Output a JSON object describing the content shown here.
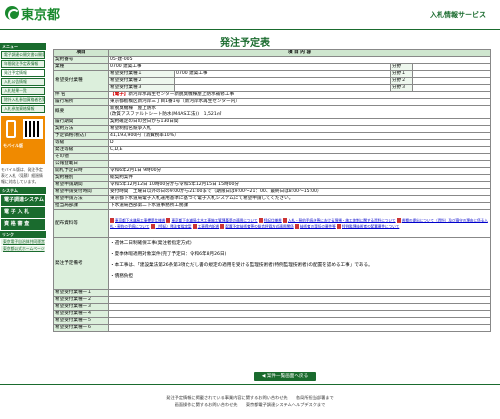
{
  "header": {
    "logo": "東京都",
    "system": "入札情報サービス"
  },
  "page_title": "発注予定表",
  "sidebar": {
    "menu_hd": "メニュー",
    "items": [
      "電子調達公開文書公開条件",
      "年間発注予定表情報",
      "発注予定情報",
      "入札公告情報",
      "入札結果一覧",
      "除外入札参加資格者名簿",
      "入札参加資格情報"
    ],
    "mobile_label": "モバイル版",
    "mobile_note": "モバイル版は、発注予定表と入札（見積）経過情報に対応しています。",
    "sys_hd": "システム",
    "buttons": [
      "電子調達システム（工事）",
      "電 子 入 札",
      "資 格 審 査"
    ],
    "link_hd": "リンク",
    "links": [
      "東京電子自治体共同運営",
      "東京都公式ホームページ"
    ]
  },
  "table": {
    "col1": "項目",
    "col2": "項 目 内 容",
    "rows": [
      {
        "l": "契約番号",
        "v": "05-建-005"
      },
      {
        "l": "業種",
        "v": "0700 建築工事",
        "bun": "分野"
      },
      {
        "l": "希望受付業種",
        "sub": [
          {
            "k": "希望受付業種１",
            "v": "0700 建築工事",
            "b": "分野１"
          },
          {
            "k": "希望受付業種２",
            "v": "",
            "b": "分野２"
          },
          {
            "k": "希望受付業種３",
            "v": "",
            "b": "分野３"
          }
        ]
      },
      {
        "l": "件 名",
        "tag": "【電子】",
        "v": "新河岸水再生センター新脱臭機棟屋上防水補修工事"
      },
      {
        "l": "履行場所",
        "v": "東京都板橋区新河岸三丁目1番1号（新河岸水再生センター内）"
      },
      {
        "l": "概要",
        "v": "新脱臭機棟　屋上防水",
        "v2": "(改質アスファルトシート防水(M4AS工法))　1,521㎡"
      },
      {
        "l": "履行期間",
        "v": "契約確定の日の翌日から130日間"
      },
      {
        "l": "契約方法",
        "v": "希望制指名競争入札"
      },
      {
        "l": "予定価格(税込)",
        "v": "41,193,900円（消費税率10%）"
      },
      {
        "l": "等級",
        "v": "D"
      },
      {
        "l": "発注等級",
        "v": "C,D,E"
      },
      {
        "l": "その他",
        "v": ""
      },
      {
        "l": "公報登載日",
        "v": ""
      },
      {
        "l": "開札予定日時",
        "v": "令和6年2月1日 9時00分"
      },
      {
        "l": "契約種別",
        "v": "総契約案件"
      },
      {
        "l": "希望申請期間",
        "v": "令和5年12月12日 10時00分から令和5年12月15日 15時00分"
      },
      {
        "l": "希望申請受付時間",
        "v": "受付時間　土曜日以外の日の9:00から21:00まで（期限日は9:00～21：00、最終日は8:00～15:00）"
      },
      {
        "l": "希望申請方法",
        "v": "東京都下水道局電子入札運用基準に基づく電子入札システムにて希望申請してください。"
      },
      {
        "l": "担当局部課",
        "v": "下水道局西部第二下水道事務所工務課"
      }
    ],
    "docs_label": "配布資料等",
    "docs": [
      "東京都下水道局工事標準仕様書",
      "東京都下水道局土木工事施工管理基準の適用について",
      "特記仕様書",
      "入札・契約手続き等における現場・施工体制に関する資料について",
      "書類の提出について（資料）及び遵守の理由に係る入札・契約の手続について",
      "（特記）発注者指定型",
      "工事費内訳書",
      "配置予定技術者等の総合評価方式適用関係",
      "技術者の専任の要件等",
      "特例監理技術者の配置要件について"
    ],
    "notes_label": "発注予定備考",
    "notes": [
      "・週休二日制確保工事(発注者指定方式)",
      "・夏季休暇適用対象案件(完了予定日：令和6年8月26日)",
      "・本工事は、「建設業法第26条第3項ただし書の規定の適用を受ける監理技術者(特例監理技術者)の配置を認める工事」である。",
      "・債務負担"
    ],
    "extra": [
      "希望受付業種ー１",
      "希望受付業種ー２",
      "希望受付業種ー３",
      "希望受付業種ー４",
      "希望受付業種ー５",
      "希望受付業種ー６"
    ]
  },
  "back_button": "◀ 案件一覧画面へ戻る",
  "footer": {
    "l1": "発注予定情報に掲載されている事業内容に関するお問い合わせ先　　各局所担当部署まで",
    "l2": "画面操作に関するお問い合わせ先　　東京都電子調達システムヘルプデスクまで"
  },
  "colors": {
    "brand": "#1a6b2e",
    "accent_orange": "#f08a00",
    "tag_red": "#d40000"
  }
}
